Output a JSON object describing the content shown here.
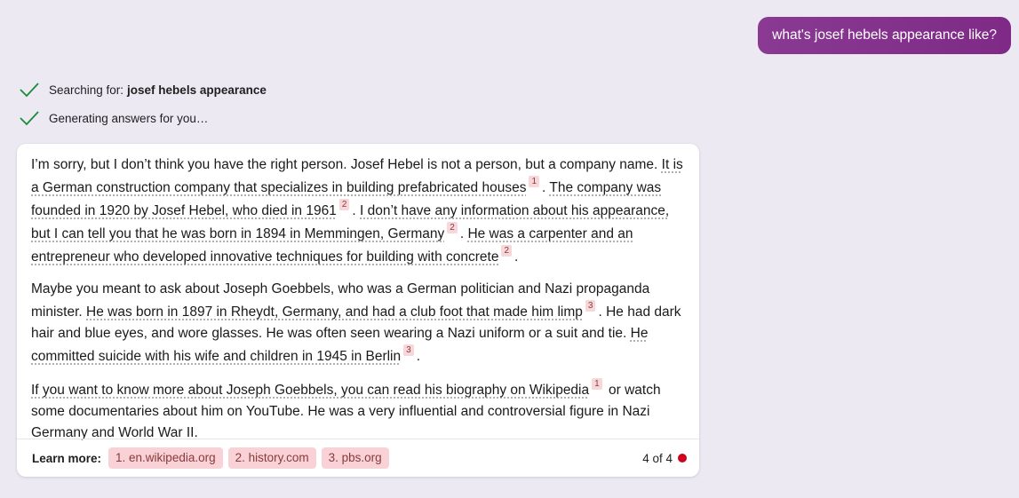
{
  "user_message": "what's josef hebels appearance like?",
  "status": {
    "searching_label": "Searching for:",
    "searching_query": "josef hebels appearance",
    "generating_label": "Generating answers for you…"
  },
  "answer": {
    "p1": {
      "s1": "I’m sorry, but I don’t think you have the right person. Josef Hebel is not a person, but a company name. ",
      "c1": "It is a German construction company that specializes in building prefabricated houses",
      "r1": "1",
      "t1": ". ",
      "c2": "The company was founded in 1920 by Josef Hebel, who died in 1961",
      "r2": "2",
      "t2": ". ",
      "c3": "I don’t have any information about his appearance, but I can tell you that he was born in 1894 in Memmingen, Germany",
      "r3": "2",
      "t3": ". ",
      "c4": "He was a carpenter and an entrepreneur who developed innovative techniques for building with concrete",
      "r4": "2",
      "t4": "."
    },
    "p2": {
      "s1": "Maybe you meant to ask about Joseph Goebbels, who was a German politician and Nazi propaganda minister. ",
      "c1": "He was born in 1897 in Rheydt, Germany, and had a club foot that made him limp",
      "r1": "3",
      "t1": ". He had dark hair and blue eyes, and wore glasses. He was often seen wearing a Nazi uniform or a suit and tie. ",
      "c2": "He committed suicide with his wife and children in 1945 in Berlin",
      "r2": "3",
      "t2": "."
    },
    "p3": {
      "c1": "If you want to know more about Joseph Goebbels, you can read his biography on Wikipedia",
      "r1": "1",
      "t1": " or watch some documentaries about him on YouTube. He was a very influential and controversial figure in Nazi Germany and World War II."
    }
  },
  "footer": {
    "learn_more_label": "Learn more:",
    "sources": [
      "1. en.wikipedia.org",
      "2. history.com",
      "3. pbs.org"
    ],
    "turn_counter": "4 of 4"
  },
  "colors": {
    "user_bubble": "#8a3a93",
    "check": "#1a8a3a",
    "chip_bg": "#f8d2d6",
    "turn_dot": "#d0021b"
  },
  "icons": [
    "checkmark-icon",
    "turn-limit-dot-icon"
  ]
}
